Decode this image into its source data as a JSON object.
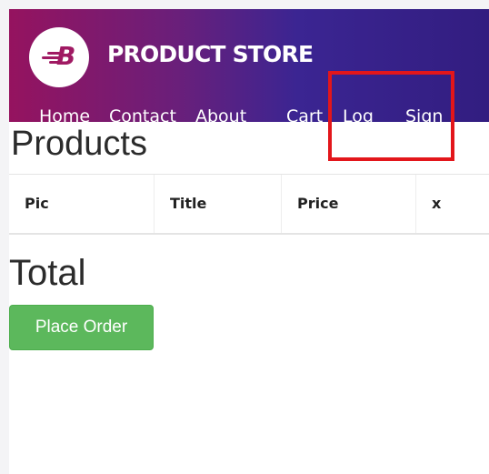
{
  "navbar": {
    "brand": "PRODUCT STORE",
    "logo_letter": "B",
    "links": {
      "home": "Home",
      "contact": "Contact",
      "about": "About",
      "cart": "Cart",
      "login": "Log",
      "signup": "Sign"
    }
  },
  "main": {
    "title": "Products",
    "table": {
      "headers": [
        "Pic",
        "Title",
        "Price",
        "x"
      ]
    },
    "total_label": "Total",
    "place_order_label": "Place Order"
  },
  "colors": {
    "navbar_gradient": [
      "#95135f",
      "#3b2592",
      "#321d80"
    ],
    "success_button": "#5cb85c",
    "highlight_box": "#e3161b"
  }
}
